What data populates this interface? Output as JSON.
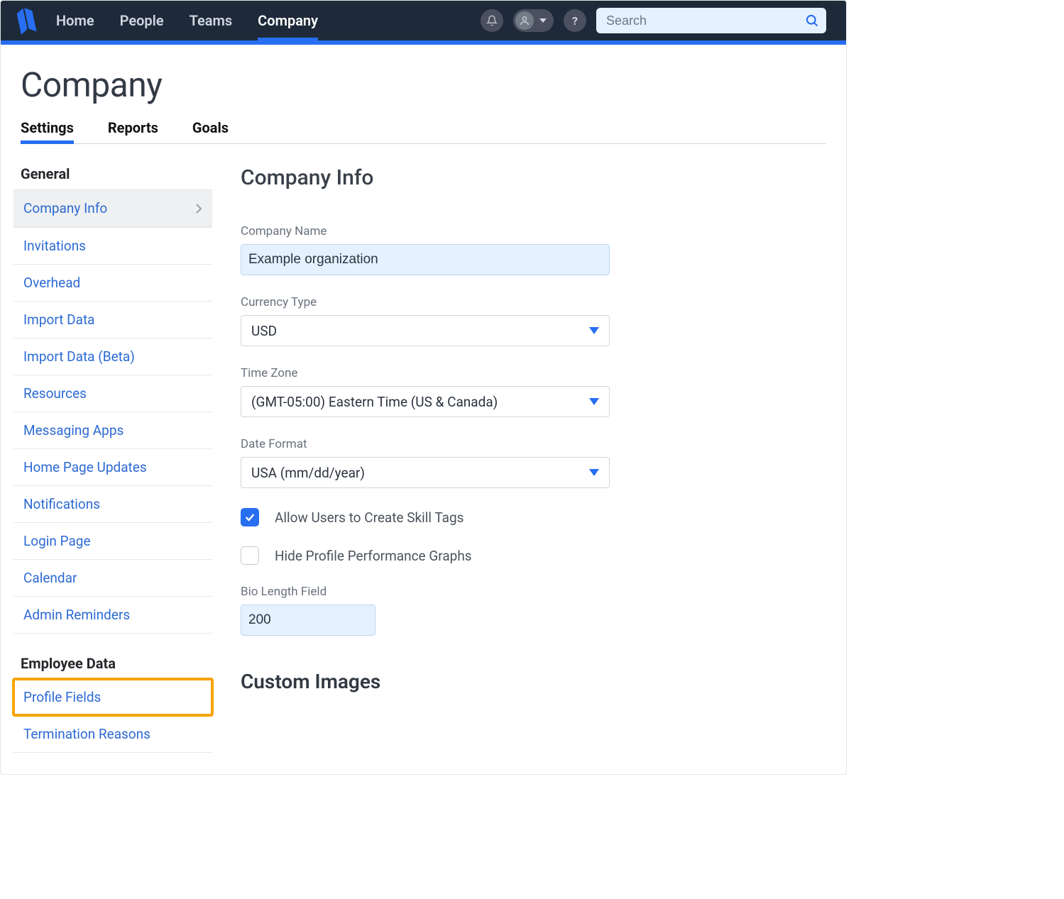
{
  "topnav": {
    "items": [
      {
        "label": "Home",
        "active": false
      },
      {
        "label": "People",
        "active": false
      },
      {
        "label": "Teams",
        "active": false
      },
      {
        "label": "Company",
        "active": true
      }
    ]
  },
  "search": {
    "placeholder": "Search"
  },
  "page": {
    "title": "Company",
    "subtabs": [
      {
        "label": "Settings",
        "active": true
      },
      {
        "label": "Reports",
        "active": false
      },
      {
        "label": "Goals",
        "active": false
      }
    ]
  },
  "sidebar": {
    "sections": [
      {
        "title": "General",
        "items": [
          {
            "label": "Company Info",
            "selected": true
          },
          {
            "label": "Invitations"
          },
          {
            "label": "Overhead"
          },
          {
            "label": "Import Data"
          },
          {
            "label": "Import Data (Beta)"
          },
          {
            "label": "Resources"
          },
          {
            "label": "Messaging Apps"
          },
          {
            "label": "Home Page Updates"
          },
          {
            "label": "Notifications"
          },
          {
            "label": "Login Page"
          },
          {
            "label": "Calendar"
          },
          {
            "label": "Admin Reminders"
          }
        ]
      },
      {
        "title": "Employee Data",
        "items": [
          {
            "label": "Profile Fields",
            "highlight": true
          },
          {
            "label": "Termination Reasons"
          }
        ]
      }
    ]
  },
  "main": {
    "heading": "Company Info",
    "company_name_label": "Company Name",
    "company_name_value": "Example organization",
    "currency_label": "Currency Type",
    "currency_value": "USD",
    "timezone_label": "Time Zone",
    "timezone_value": "(GMT-05:00) Eastern Time (US & Canada)",
    "dateformat_label": "Date Format",
    "dateformat_value": "USA (mm/dd/year)",
    "allow_skill_tags_label": "Allow Users to Create Skill Tags",
    "allow_skill_tags_checked": true,
    "hide_graphs_label": "Hide Profile Performance Graphs",
    "hide_graphs_checked": false,
    "bio_length_label": "Bio Length Field",
    "bio_length_value": "200",
    "custom_images_heading": "Custom Images"
  }
}
